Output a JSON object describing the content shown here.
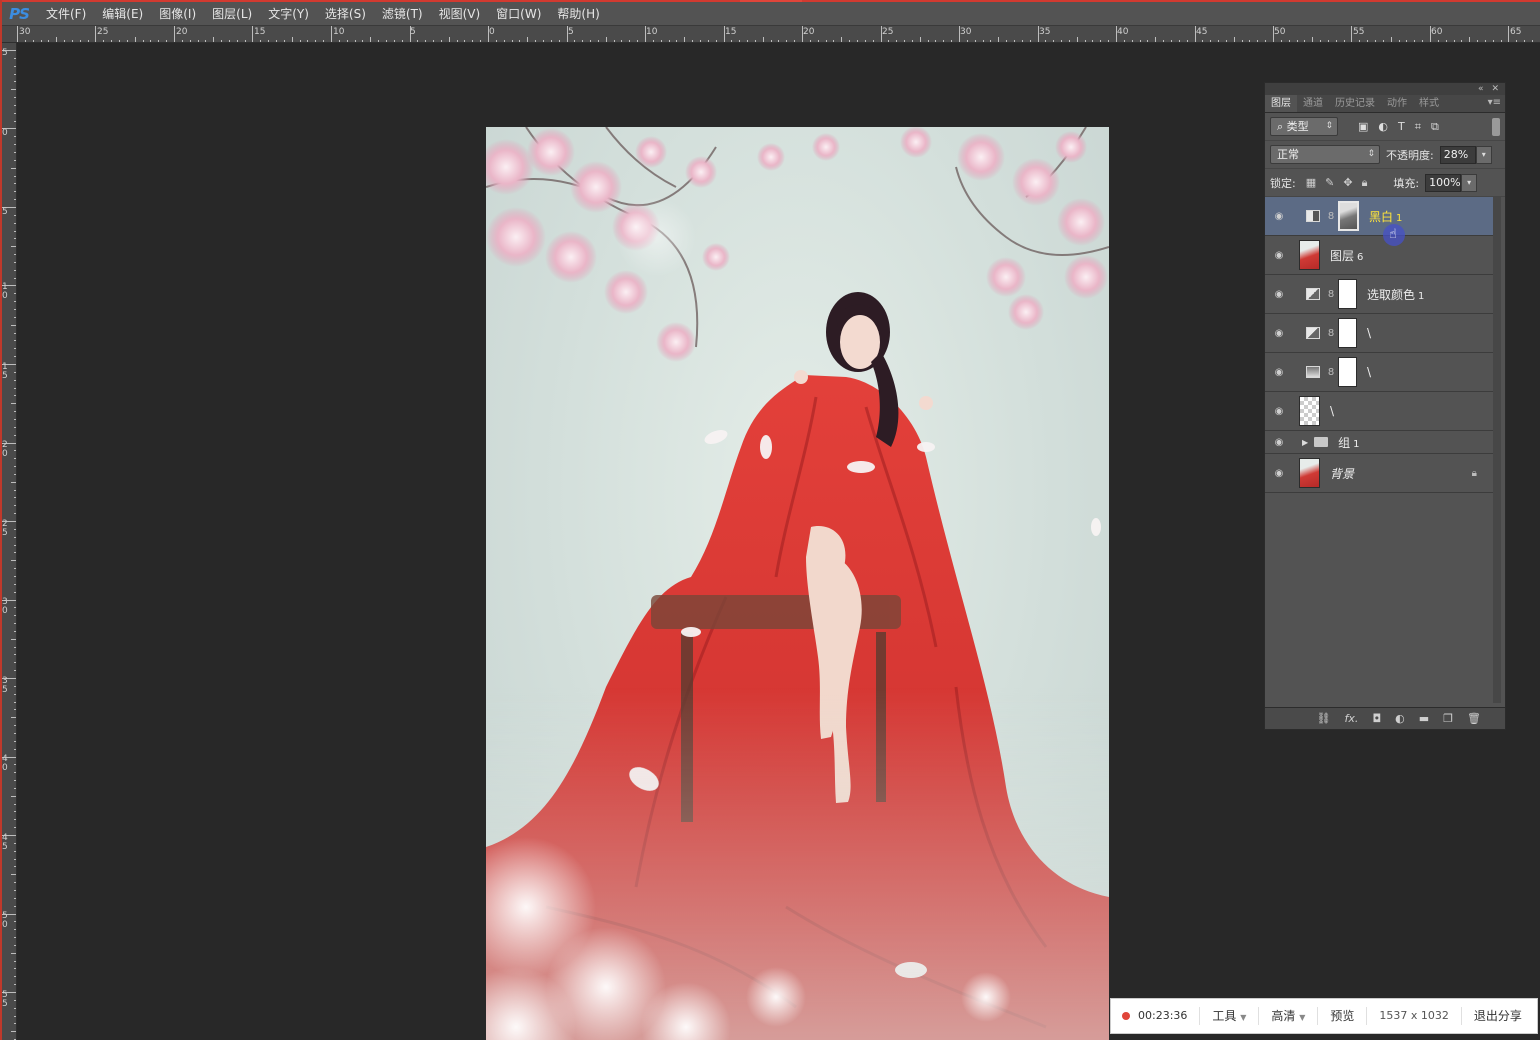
{
  "menubar": {
    "logo": "PS",
    "items": [
      "文件(F)",
      "编辑(E)",
      "图像(I)",
      "图层(L)",
      "文字(Y)",
      "选择(S)",
      "滤镜(T)",
      "视图(V)",
      "窗口(W)",
      "帮助(H)"
    ]
  },
  "ruler_h": [
    "30",
    "25",
    "20",
    "15",
    "10",
    "5",
    "0",
    "5",
    "10",
    "15",
    "20",
    "25",
    "30",
    "35",
    "40",
    "45",
    "50",
    "55",
    "60",
    "65"
  ],
  "ruler_v": [
    "5",
    "0",
    "5",
    "1 0",
    "1 5",
    "2 0",
    "2 5",
    "3 0",
    "3 5",
    "4 0",
    "4 5",
    "5 0",
    "5 5"
  ],
  "layers_panel": {
    "tabs": [
      "图层",
      "通道",
      "历史记录",
      "动作",
      "样式"
    ],
    "filter_kind": "类型",
    "blend_mode": "正常",
    "opacity_label": "不透明度:",
    "opacity_value": "28%",
    "lock_label": "锁定:",
    "fill_label": "填充:",
    "fill_value": "100%",
    "layers": [
      {
        "name": "黑白",
        "num": "1",
        "type": "bw-adjust",
        "selected": true
      },
      {
        "name": "图层",
        "num": "6",
        "type": "image"
      },
      {
        "name": "选取颜色",
        "num": "1",
        "type": "selective-color"
      },
      {
        "name": "\\",
        "num": "",
        "type": "selective-color"
      },
      {
        "name": "\\",
        "num": "",
        "type": "curves"
      },
      {
        "name": "\\",
        "num": "",
        "type": "transparent"
      },
      {
        "name": "组",
        "num": "1",
        "type": "group"
      },
      {
        "name": "背景",
        "num": "",
        "type": "background"
      }
    ],
    "bottom_icons": [
      "link-icon",
      "fx-icon",
      "mask-icon",
      "adjustment-icon",
      "folder-icon",
      "new-layer-icon",
      "trash-icon"
    ]
  },
  "recording_bar": {
    "time": "00:23:36",
    "tools": "工具",
    "quality": "高清",
    "preview": "预览",
    "resolution": "1537 x 1032",
    "exit": "退出分享"
  }
}
